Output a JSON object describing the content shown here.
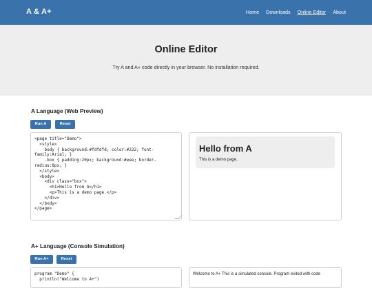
{
  "header": {
    "logo": "A & A+",
    "nav": [
      "Home",
      "Downloads",
      "Online Editor",
      "About"
    ]
  },
  "hero": {
    "title": "Online Editor",
    "subtitle": "Try A and A+ code directly in your browser. No installation required."
  },
  "section_a": {
    "title": "A Language (Web Preview)",
    "run_label": "Run A",
    "reset_label": "Reset",
    "code": "<page title=\"Demo\">\n  <style>\n    body { background:#fdfdfd; color:#222; font-family:Arial; }\n    .box { padding:20px; background:#eee; border-radius:8px; }\n  </style>\n  <body>\n    <div class=\"box\">\n      <h1>Hello from A</h1>\n      <p>This is a demo page.</p>\n    </div>\n  </body>\n</page>",
    "preview_heading": "Hello from A",
    "preview_paragraph": "This is a demo page."
  },
  "section_aplus": {
    "title": "A+ Language (Console Simulation)",
    "run_label": "Run A+",
    "reset_label": "Reset",
    "code": "program \"Demo\" {\n  println(\"Welcome to A+\")",
    "console_output": "Welcome to A+ This is a simulated console. Program exited with code"
  },
  "colors": {
    "header_bg": "#3a72ab",
    "hero_bg": "#eeeeee",
    "button_bg": "#3a72ab"
  }
}
